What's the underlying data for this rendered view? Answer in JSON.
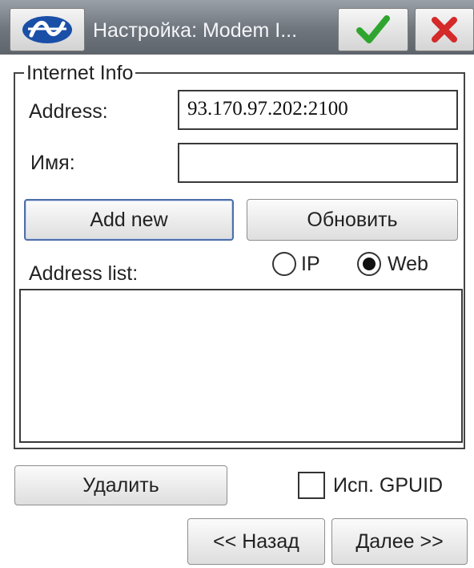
{
  "titlebar": {
    "logo_icon": "app-logo-icon",
    "title": "Настройка: Modem I...",
    "ok_icon": "checkmark-icon",
    "close_icon": "close-x-icon",
    "colors": {
      "check": "#2fa52f",
      "close": "#d42a2a",
      "logo": "#1a4fa8"
    }
  },
  "group": {
    "legend": "Internet Info"
  },
  "address": {
    "label": "Address:",
    "value": "93.170.97.202:2100"
  },
  "name": {
    "label": "Имя:",
    "value": ""
  },
  "buttons": {
    "add_new": "Add new",
    "refresh": "Обновить",
    "delete": "Удалить",
    "back": "<< Назад",
    "next": "Далее >>"
  },
  "address_list": {
    "label": "Address list:",
    "items": []
  },
  "mode": {
    "options": [
      "IP",
      "Web"
    ],
    "selected": "Web"
  },
  "gpuid": {
    "label": "Исп. GPUID",
    "checked": false
  }
}
